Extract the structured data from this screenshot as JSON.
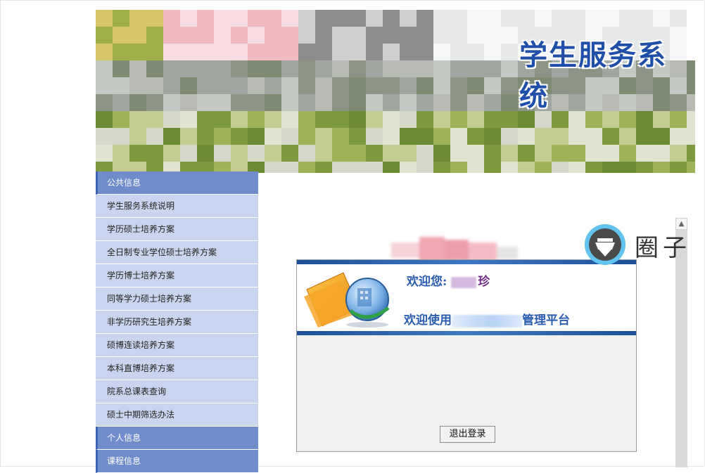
{
  "header": {
    "title": "学生服务系统"
  },
  "sidebar": {
    "sections": [
      {
        "label": "公共信息"
      },
      {
        "label": "个人信息"
      },
      {
        "label": "课程信息"
      }
    ],
    "items": [
      {
        "label": "学生服务系统说明"
      },
      {
        "label": "学历硕士培养方案"
      },
      {
        "label": "全日制专业学位硕士培养方案"
      },
      {
        "label": "学历博士培养方案"
      },
      {
        "label": "同等学力硕士培养方案"
      },
      {
        "label": "非学历研究生培养方案"
      },
      {
        "label": "硕博连读培养方案"
      },
      {
        "label": "本科直博培养方案"
      },
      {
        "label": "院系总课表查询"
      },
      {
        "label": "硕士中期筛选办法"
      }
    ]
  },
  "main": {
    "welcome_prefix": "欢迎您:",
    "welcome_name_suffix": "珍",
    "platform_prefix": "欢迎使用",
    "platform_suffix": "管理平台",
    "logout_label": "退出登录"
  },
  "watermark": {
    "text": "圈子"
  },
  "colors": {
    "title": "#1f4fa8",
    "sidebar_header": "#6f8dcb",
    "sidebar_item": "#c9d5ee",
    "welcome_text": "#2a5db0"
  }
}
